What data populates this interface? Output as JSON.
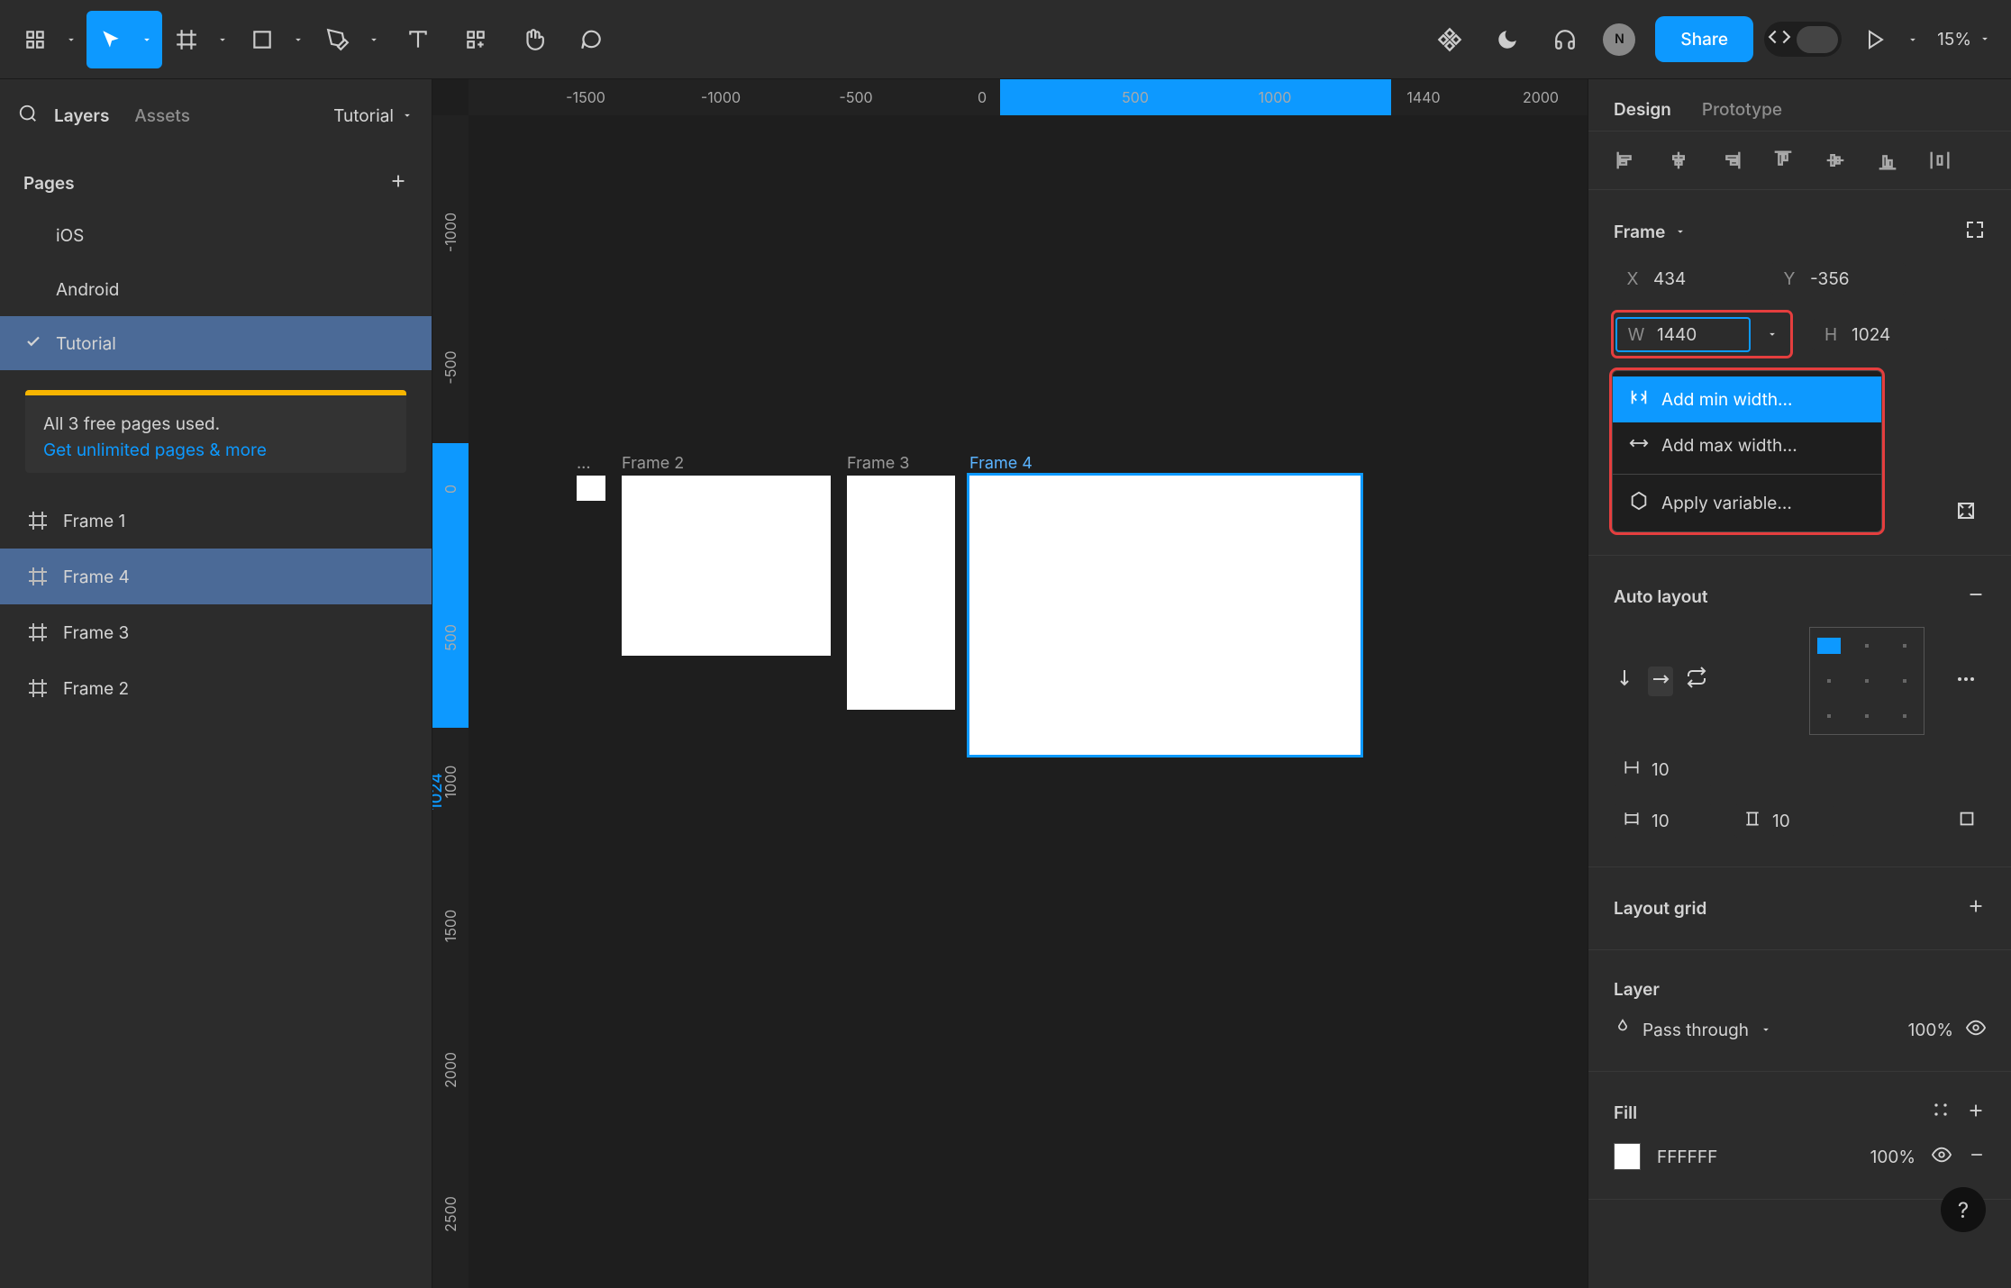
{
  "toolbar": {
    "share_label": "Share",
    "avatar_initial": "N",
    "zoom_label": "15%"
  },
  "left_panel": {
    "tab_layers": "Layers",
    "tab_assets": "Assets",
    "file_label": "Tutorial",
    "pages_label": "Pages",
    "pages": [
      {
        "name": "iOS"
      },
      {
        "name": "Android"
      },
      {
        "name": "Tutorial"
      }
    ],
    "upgrade_line1": "All 3 free pages used.",
    "upgrade_link": "Get unlimited pages & more",
    "layers": [
      {
        "name": "Frame 1"
      },
      {
        "name": "Frame 4"
      },
      {
        "name": "Frame 3"
      },
      {
        "name": "Frame 2"
      }
    ]
  },
  "canvas": {
    "ruler_h": [
      "-1500",
      "-1000",
      "-500",
      "0",
      "500",
      "1000",
      "1440",
      "2000"
    ],
    "ruler_v": [
      "-1000",
      "-500",
      "0",
      "500",
      "1000",
      "1500",
      "2000",
      "2500"
    ],
    "frames": [
      {
        "label": "...",
        "kind": "ellipsis"
      },
      {
        "label": "Frame 2"
      },
      {
        "label": "Frame 3"
      },
      {
        "label": "Frame 4"
      }
    ],
    "selected_dim_label": "1024"
  },
  "right_panel": {
    "tab_design": "Design",
    "tab_prototype": "Prototype",
    "frame_section_title": "Frame",
    "x_label": "X",
    "x_value": "434",
    "y_label": "Y",
    "y_value": "-356",
    "w_label": "W",
    "w_value": "1440",
    "h_label": "H",
    "h_value": "1024",
    "width_menu": {
      "add_min": "Add min width...",
      "add_max": "Add max width...",
      "apply_var": "Apply variable..."
    },
    "auto_layout_title": "Auto layout",
    "gap_value": "10",
    "pad_h_value": "10",
    "pad_v_value": "10",
    "layout_grid_title": "Layout grid",
    "layer_title": "Layer",
    "blend_mode": "Pass through",
    "opacity_value": "100%",
    "fill_title": "Fill",
    "fill_hex": "FFFFFF",
    "fill_opacity": "100%"
  }
}
